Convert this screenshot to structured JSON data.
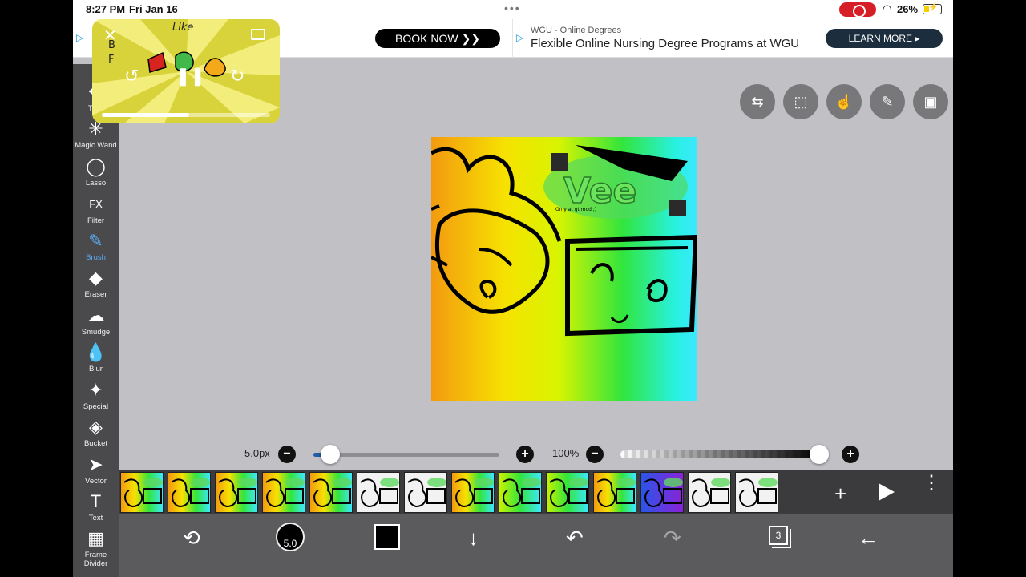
{
  "status_bar": {
    "time": "8:27 PM",
    "date": "Fri Jan 16",
    "battery_pct": "26%"
  },
  "ads": {
    "left": {
      "button": "BOOK NOW  ❯❯"
    },
    "right": {
      "source": "WGU - Online Degrees",
      "headline": "Flexible Online Nursing Degree Programs at WGU",
      "button": "LEARN MORE  ▸"
    }
  },
  "pip": {
    "close_glyph": "✕",
    "rewind_glyph": "↺",
    "pause_glyph": "❚❚",
    "forward_glyph": "↻",
    "progress": 0.52
  },
  "toolbar": {
    "items": [
      {
        "label": "Tran",
        "glyph": "✥"
      },
      {
        "label": "Magic Wand",
        "glyph": "✳"
      },
      {
        "label": "Lasso",
        "glyph": "◯"
      },
      {
        "label": "Filter",
        "glyph": "FX"
      },
      {
        "label": "Brush",
        "glyph": "✎"
      },
      {
        "label": "Eraser",
        "glyph": "◆"
      },
      {
        "label": "Smudge",
        "glyph": "☁"
      },
      {
        "label": "Blur",
        "glyph": "💧"
      },
      {
        "label": "Special",
        "glyph": "✦"
      },
      {
        "label": "Bucket",
        "glyph": "◈"
      },
      {
        "label": "Vector",
        "glyph": "➤"
      },
      {
        "label": "Text",
        "glyph": "T"
      },
      {
        "label": "Frame Divider",
        "glyph": "▦"
      }
    ]
  },
  "top_right_buttons": [
    {
      "name": "toggle",
      "glyph": "⇆"
    },
    {
      "name": "selection",
      "glyph": "⬚"
    },
    {
      "name": "gesture",
      "glyph": "☝"
    },
    {
      "name": "ruler",
      "glyph": "✎"
    },
    {
      "name": "material",
      "glyph": "▣"
    }
  ],
  "brush_controls": {
    "size_label": "5.0px",
    "size_fraction": 0.09,
    "opacity_label": "100%",
    "opacity_fraction": 1.0,
    "minus": "−",
    "plus": "+"
  },
  "frames_strip": {
    "frames": [
      "rainbow",
      "rainbow",
      "rainbow",
      "rainbow",
      "rainbow",
      "white",
      "white",
      "rainbow",
      "green",
      "green",
      "rainbow",
      "blue",
      "white",
      "white"
    ],
    "add_glyph": "+",
    "more_glyph": "⋮"
  },
  "bottom_bar": {
    "brush_size": "5.0",
    "layer_count": "3",
    "modify_glyph": "⟲",
    "download_glyph": "↓",
    "undo_glyph": "↶",
    "redo_glyph": "↷",
    "back_glyph": "←"
  },
  "colors": {
    "toolbar_bg": "#4a4a4c",
    "active_tool": "#5aaaf0",
    "canvas_bg": "#c1c0c5",
    "current_color": "#000000"
  }
}
